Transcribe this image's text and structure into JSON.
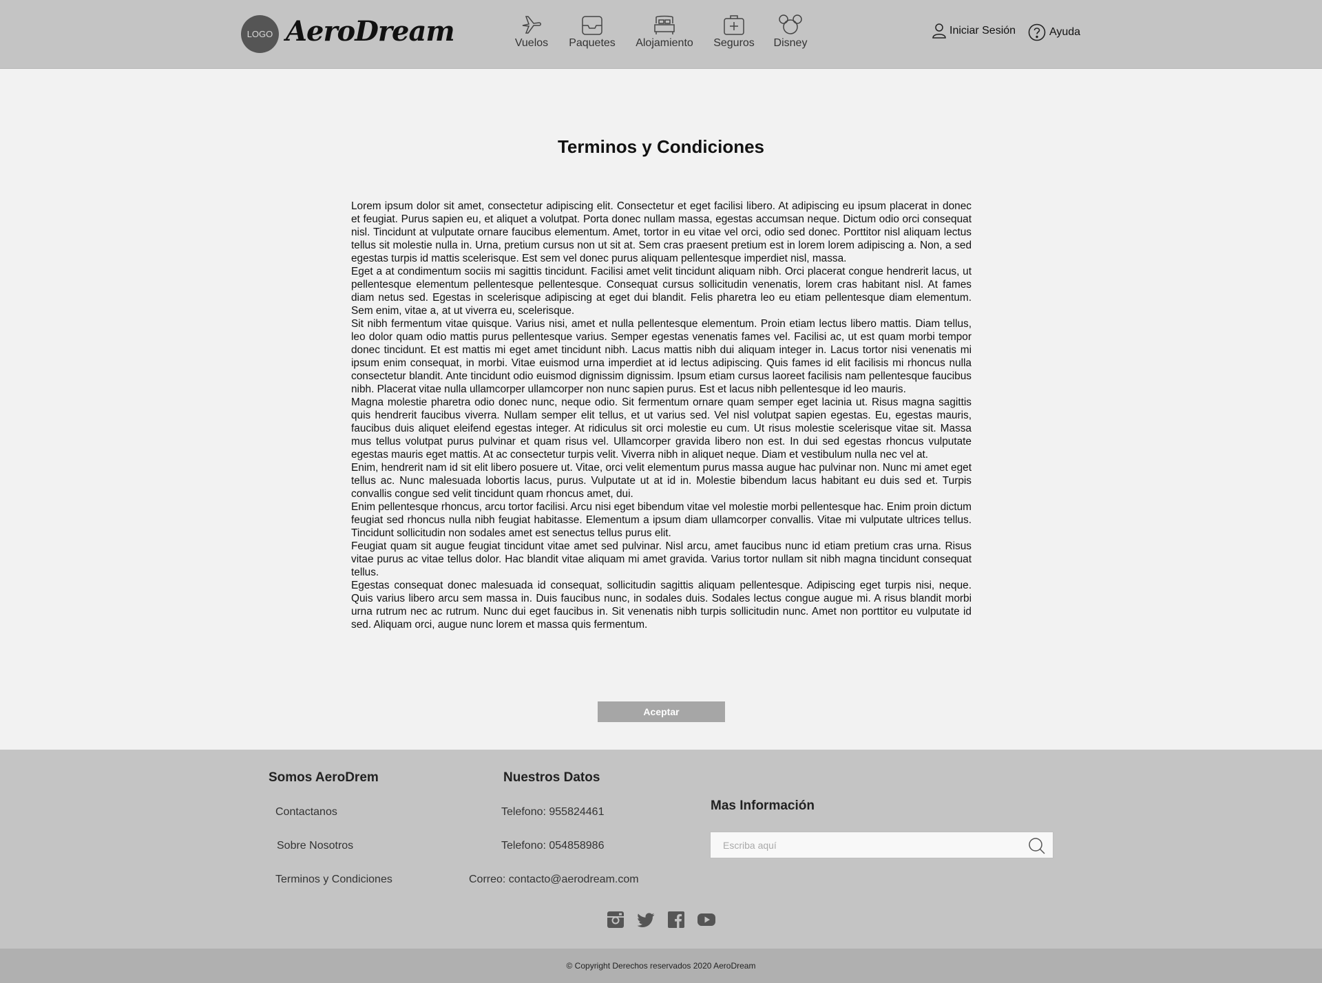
{
  "header": {
    "logo_text": "LOGO",
    "brand": "AeroDream",
    "nav": [
      {
        "label": "Vuelos",
        "icon": "plane-icon"
      },
      {
        "label": "Paquetes",
        "icon": "package-icon"
      },
      {
        "label": "Alojamiento",
        "icon": "bed-icon"
      },
      {
        "label": "Seguros",
        "icon": "medical-kit-icon"
      },
      {
        "label": "Disney",
        "icon": "mickey-icon"
      }
    ],
    "login_label": "Iniciar Sesión",
    "help_label": "Ayuda"
  },
  "main": {
    "title": "Terminos y Condiciones",
    "paragraphs": [
      "Lorem ipsum dolor sit amet, consectetur adipiscing elit. Consectetur et eget facilisi libero. At adipiscing eu ipsum placerat in donec et feugiat. Purus sapien eu, et aliquet a volutpat. Porta donec nullam massa, egestas accumsan neque. Dictum odio orci consequat nisl. Tincidunt at vulputate ornare faucibus elementum. Amet, tortor in eu vitae vel orci, odio sed donec. Porttitor nisl aliquam lectus tellus sit molestie nulla in. Urna, pretium cursus non ut sit at. Sem cras praesent pretium est in lorem lorem adipiscing a. Non, a sed egestas turpis id mattis scelerisque. Est sem vel donec purus aliquam pellentesque imperdiet nisl, massa.",
      "Eget a at condimentum sociis mi sagittis tincidunt. Facilisi amet velit tincidunt aliquam nibh. Orci placerat congue hendrerit lacus, ut pellentesque elementum pellentesque pellentesque. Consequat cursus sollicitudin venenatis, lorem cras habitant nisl. At fames diam netus sed. Egestas in scelerisque adipiscing at eget dui blandit. Felis pharetra leo eu etiam pellentesque diam elementum. Sem enim, vitae a, at ut viverra eu, scelerisque.",
      "Sit nibh fermentum vitae quisque. Varius nisi, amet et nulla pellentesque elementum. Proin etiam lectus libero mattis. Diam tellus, leo dolor quam odio mattis purus pellentesque varius. Semper egestas venenatis fames vel. Facilisi ac, ut est quam morbi tempor donec tincidunt. Et est mattis mi eget amet tincidunt nibh. Lacus mattis nibh dui aliquam integer in. Lacus tortor nisi venenatis mi ipsum enim consequat, in morbi. Vitae euismod urna imperdiet at id lectus adipiscing. Quis fames id elit facilisis mi rhoncus nulla consectetur blandit. Ante tincidunt odio euismod dignissim dignissim. Ipsum etiam cursus laoreet facilisis nam pellentesque faucibus nibh. Placerat vitae nulla ullamcorper ullamcorper non nunc sapien purus. Est et lacus nibh pellentesque id leo mauris.",
      "Magna molestie pharetra odio donec nunc, neque odio. Sit fermentum ornare quam semper eget lacinia ut. Risus magna sagittis quis hendrerit faucibus viverra. Nullam semper elit tellus, et ut varius sed. Vel nisl volutpat sapien egestas. Eu, egestas mauris, faucibus duis aliquet eleifend egestas integer. At ridiculus sit orci molestie eu cum. Ut risus molestie scelerisque vitae sit. Massa mus tellus volutpat purus pulvinar et quam risus vel. Ullamcorper gravida libero non est. In dui sed egestas rhoncus vulputate egestas mauris eget mattis. At ac consectetur turpis velit. Viverra nibh in aliquet neque. Diam et vestibulum nulla nec vel at.",
      "Enim, hendrerit nam id sit elit libero posuere ut. Vitae, orci velit elementum purus massa augue hac pulvinar non. Nunc mi amet eget tellus ac. Nunc malesuada lobortis lacus, purus. Vulputate ut at id in. Molestie bibendum lacus habitant eu duis sed et. Turpis convallis congue sed velit tincidunt quam rhoncus amet, dui.",
      "Enim pellentesque rhoncus, arcu tortor facilisi. Arcu nisi eget bibendum vitae vel molestie morbi pellentesque hac. Enim proin dictum feugiat sed rhoncus nulla nibh feugiat habitasse. Elementum a ipsum diam ullamcorper convallis. Vitae mi vulputate ultrices tellus. Tincidunt sollicitudin non sodales amet est senectus tellus purus elit.",
      "Feugiat quam sit augue feugiat tincidunt vitae amet sed pulvinar. Nisl arcu, amet faucibus nunc id etiam pretium cras urna. Risus vitae purus ac vitae tellus dolor. Hac blandit vitae aliquam mi amet gravida. Varius tortor nullam sit nibh magna tincidunt consequat tellus.",
      "Egestas consequat donec malesuada id consequat, sollicitudin sagittis aliquam pellentesque. Adipiscing eget turpis nisi, neque. Quis varius libero arcu sem massa in. Duis faucibus nunc, in sodales duis. Sodales lectus congue augue mi. A risus blandit morbi urna rutrum nec ac rutrum. Nunc dui eget faucibus in. Sit venenatis nibh turpis sollicitudin nunc. Amet non porttitor eu vulputate id sed. Aliquam orci, augue nunc lorem et massa quis fermentum."
    ],
    "accept_label": "Aceptar"
  },
  "footer": {
    "col1_title": "Somos AeroDrem",
    "col1_links": [
      "Contactanos",
      "Sobre Nosotros",
      "Terminos y Condiciones"
    ],
    "col2_title": "Nuestros Datos",
    "col2_items": [
      "Telefono: 955824461",
      "Telefono: 054858986",
      "Correo: contacto@aerodream.com"
    ],
    "col3_title": "Mas Información",
    "search_placeholder": "Escriba aquí",
    "socials": [
      "instagram-icon",
      "twitter-icon",
      "facebook-icon",
      "youtube-icon"
    ],
    "copyright": "© Copyright Derechos reservados 2020 AeroDream"
  }
}
